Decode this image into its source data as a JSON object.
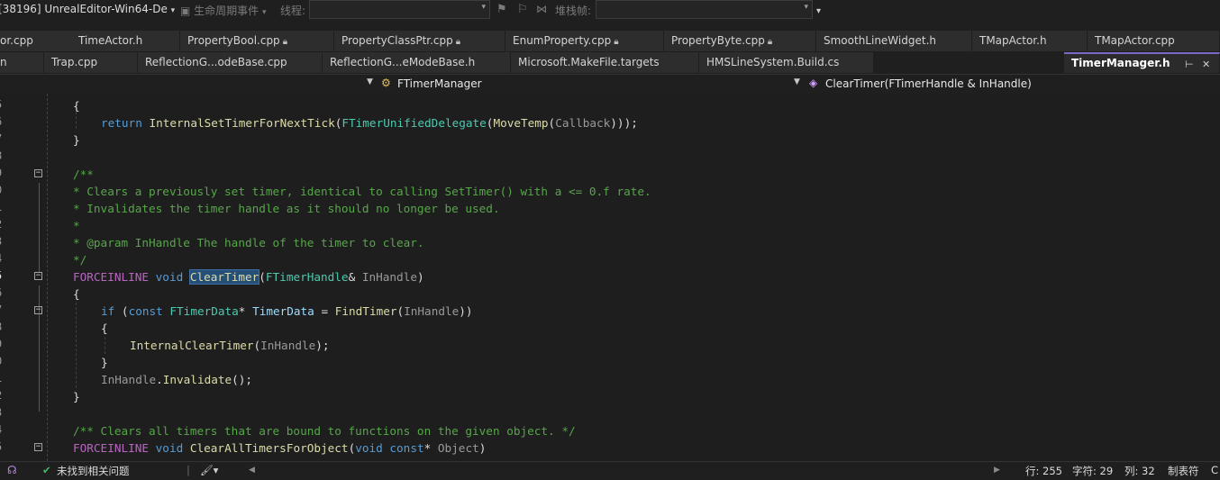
{
  "toolbar": {
    "process": "[38196] UnrealEditor-Win64-De",
    "lifecycle_events": "生命周期事件",
    "thread_label": "线程:",
    "stack_frame_label": "堆栈帧:"
  },
  "tabs_row1": [
    {
      "label": "or.cpp",
      "locked": false
    },
    {
      "label": "TimeActor.h",
      "locked": false
    },
    {
      "label": "PropertyBool.cpp",
      "locked": true
    },
    {
      "label": "PropertyClassPtr.cpp",
      "locked": true
    },
    {
      "label": "EnumProperty.cpp",
      "locked": true
    },
    {
      "label": "PropertyByte.cpp",
      "locked": true
    },
    {
      "label": "SmoothLineWidget.h",
      "locked": false
    },
    {
      "label": "TMapActor.h",
      "locked": false
    },
    {
      "label": "TMapActor.cpp",
      "locked": false
    }
  ],
  "tabs_row2": [
    {
      "label": "n",
      "locked": false
    },
    {
      "label": "Trap.cpp",
      "locked": false
    },
    {
      "label": "ReflectionG...odeBase.cpp",
      "locked": false
    },
    {
      "label": "ReflectionG...eModeBase.h",
      "locked": false
    },
    {
      "label": "Microsoft.MakeFile.targets",
      "locked": false
    },
    {
      "label": "HMSLineSystem.Build.cs",
      "locked": false
    }
  ],
  "active_tab": {
    "label": "TimerManager.h",
    "pin_icon": "pin-icon",
    "close_icon": "close-icon"
  },
  "navbar": {
    "scope": "FTimerManager",
    "member": "ClearTimer(FTimerHandle & InHandle)"
  },
  "editor": {
    "line_numbers": [
      "5",
      "6",
      "7",
      "8",
      "9",
      "0",
      "1",
      "2",
      "3",
      "4",
      "5",
      "6",
      "7",
      "8",
      "9",
      "0",
      "1",
      "2",
      "3",
      "4",
      "5"
    ],
    "current_line_index": 10,
    "code": {
      "l1": "{",
      "l2_kw": "return",
      "l2_fn": "InternalSetTimerForNextTick",
      "l2_type": "FTimerUnifiedDelegate",
      "l2_fn2": "MoveTemp",
      "l2_arg": "Callback",
      "l3": "}",
      "l5": "/**",
      "l6": "* Clears a previously set timer, identical to calling SetTimer() with a <= 0.f rate.",
      "l7": "* Invalidates the timer handle as it should no longer be used.",
      "l8": "*",
      "l9": "* @param InHandle The handle of the timer to clear.",
      "l10": "*/",
      "l11_macro": "FORCEINLINE",
      "l11_void": "void",
      "l11_fn": "ClearTimer",
      "l11_type": "FTimerHandle",
      "l11_param": "InHandle",
      "l12": "{",
      "l13_if": "if",
      "l13_const": "const",
      "l13_type": "FTimerData",
      "l13_var": "TimerData",
      "l13_fn": "FindTimer",
      "l13_arg": "InHandle",
      "l14": "{",
      "l15_fn": "InternalClearTimer",
      "l15_arg": "InHandle",
      "l16": "}",
      "l17_obj": "InHandle",
      "l17_fn": "Invalidate",
      "l18": "}",
      "l20": "/** Clears all timers that are bound to functions on the given object. */",
      "l21_macro": "FORCEINLINE",
      "l21_void": "void",
      "l21_fn": "ClearAllTimersForObject",
      "l21_void2": "void",
      "l21_const": "const",
      "l21_param": "Object"
    }
  },
  "statusbar": {
    "issues": "未找到相关问题",
    "line": "行: 255",
    "char": "字符: 29",
    "col": "列: 32",
    "tab_mode": "制表符",
    "tail": "C"
  },
  "colors": {
    "keyword": "#569cd6",
    "macro": "#bd63c5",
    "function": "#dcdcaa",
    "type": "#4ec9b0",
    "comment": "#57a64a",
    "active_tab_accent": "#7d68c8",
    "ok_status": "#3fbf5f"
  }
}
